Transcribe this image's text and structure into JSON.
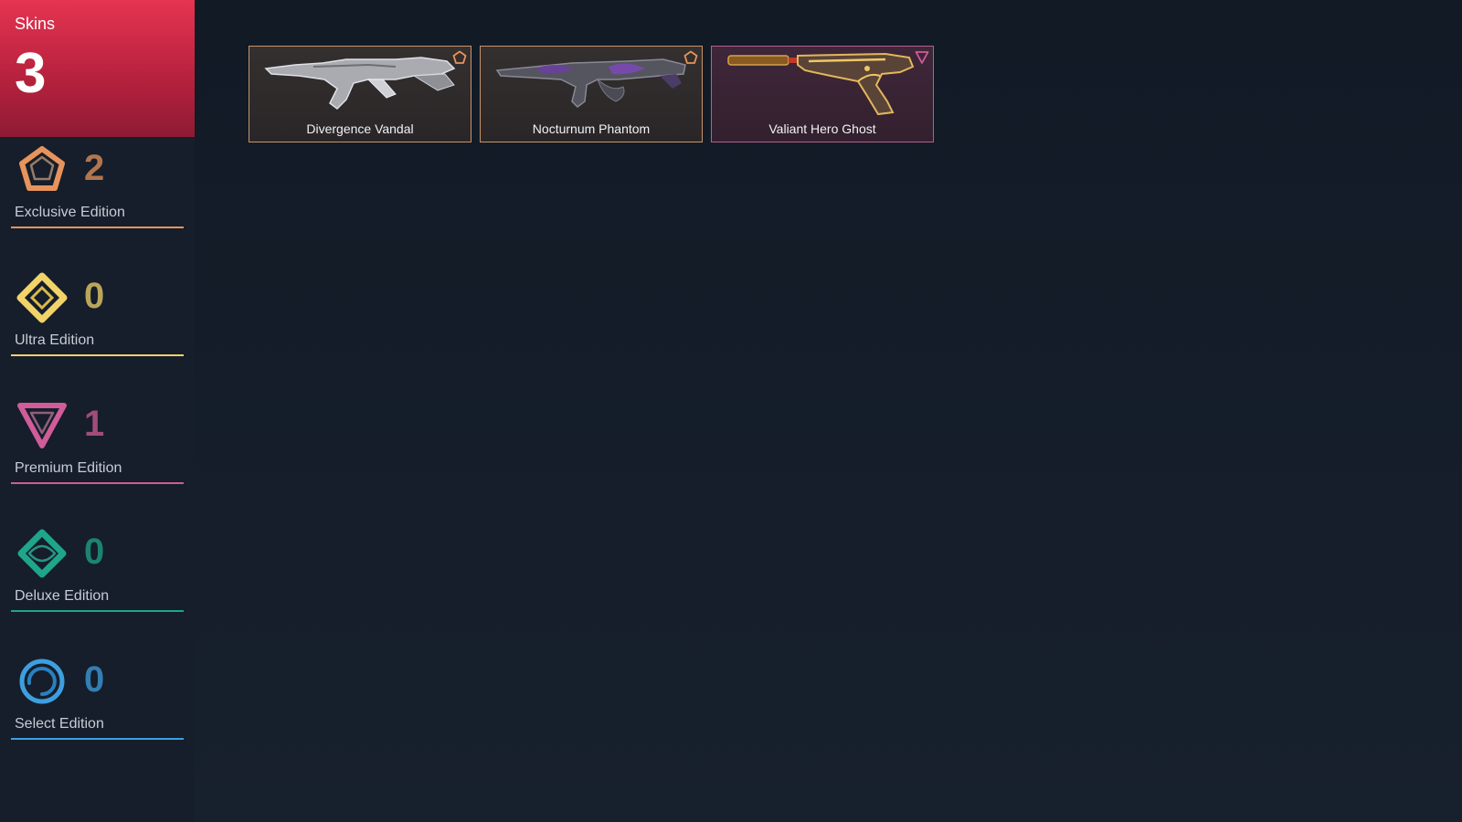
{
  "summary": {
    "label": "Skins",
    "count": "3",
    "accent": "#e53451"
  },
  "tiers": [
    {
      "name": "Exclusive Edition",
      "count": "2",
      "color": "#e7945c",
      "icon": "exclusive-edition-icon"
    },
    {
      "name": "Ultra Edition",
      "count": "0",
      "color": "#f1d36a",
      "icon": "ultra-edition-icon"
    },
    {
      "name": "Premium Edition",
      "count": "1",
      "color": "#d05c99",
      "icon": "premium-edition-icon"
    },
    {
      "name": "Deluxe Edition",
      "count": "0",
      "color": "#1fa58c",
      "icon": "deluxe-edition-icon"
    },
    {
      "name": "Select Edition",
      "count": "0",
      "color": "#3d9fe0",
      "icon": "select-edition-icon"
    }
  ],
  "skins": [
    {
      "name": "Divergence Vandal",
      "tier": "Exclusive Edition",
      "border": "#c8946a",
      "background": "#2e2a2c",
      "icon": "exclusive-edition-icon"
    },
    {
      "name": "Nocturnum Phantom",
      "tier": "Exclusive Edition",
      "border": "#c8946a",
      "background": "#2e2a2c",
      "icon": "exclusive-edition-icon"
    },
    {
      "name": "Valiant Hero Ghost",
      "tier": "Premium Edition",
      "border": "#b5608e",
      "background": "#3a2434",
      "icon": "premium-edition-icon"
    }
  ]
}
